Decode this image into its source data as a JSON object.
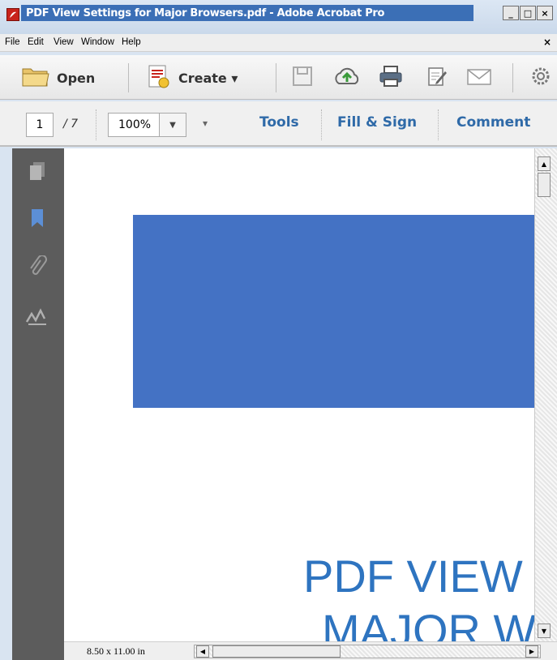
{
  "window": {
    "title": "PDF View Settings for Major Browsers.pdf - Adobe Acrobat Pro",
    "min_label": "_",
    "max_label": "□",
    "close_label": "×"
  },
  "menu": {
    "items": [
      "File",
      "Edit",
      "View",
      "Window",
      "Help"
    ],
    "close_label": "×"
  },
  "toolbar": {
    "open_label": "Open",
    "create_label": "Create ▾"
  },
  "navbar": {
    "page_number": "1",
    "page_total": "/ 7",
    "zoom": "100%",
    "zoom_drop": "▼",
    "more": "▾",
    "tabs": [
      "Tools",
      "Fill & Sign",
      "Comment"
    ]
  },
  "document": {
    "title_line1": "PDF VIEW",
    "title_line2": "MAJOR W",
    "banner_color": "#4472c4",
    "title_color": "#2e74c0"
  },
  "statusbar": {
    "page_size": "8.50 x 11.00 in"
  },
  "icons": {
    "app": "acrobat-icon",
    "open": "folder-icon",
    "create": "create-pdf-icon",
    "save": "save-icon",
    "upload": "cloud-upload-icon",
    "print": "printer-icon",
    "edit": "edit-icon",
    "email": "email-icon",
    "settings": "gear-icon",
    "pages": "pages-icon",
    "bookmarks": "bookmark-icon",
    "attachments": "paperclip-icon",
    "signatures": "signature-icon"
  }
}
